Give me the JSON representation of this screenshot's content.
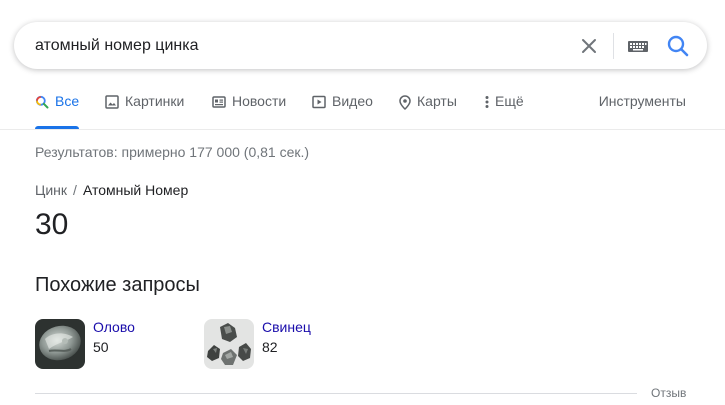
{
  "search": {
    "query": "атомный номер цинка"
  },
  "tabs": [
    {
      "label": "Все",
      "icon": "search-icon",
      "active": true
    },
    {
      "label": "Картинки",
      "icon": "image-icon"
    },
    {
      "label": "Новости",
      "icon": "news-icon"
    },
    {
      "label": "Видео",
      "icon": "video-icon"
    },
    {
      "label": "Карты",
      "icon": "map-pin-icon"
    },
    {
      "label": "Ещё",
      "icon": "more-vert-icon"
    }
  ],
  "tools_label": "Инструменты",
  "result_stats": "Результатов: примерно 177 000 (0,81 сек.)",
  "answer": {
    "breadcrumb_parent": "Цинк",
    "breadcrumb_separator": "/",
    "breadcrumb_current": "Атомный Номер",
    "value": "30"
  },
  "related": {
    "title": "Похожие запросы",
    "items": [
      {
        "name": "Олово",
        "value": "50"
      },
      {
        "name": "Свинец",
        "value": "82"
      }
    ]
  },
  "feedback_label": "Отзыв",
  "colors": {
    "accent": "#1a73e8",
    "link": "#1a0dab",
    "muted": "#70757a"
  }
}
